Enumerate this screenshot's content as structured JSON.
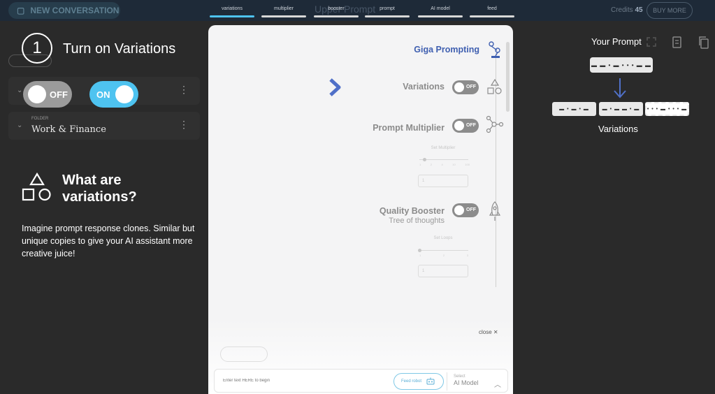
{
  "background": {
    "new_conversation": "NEW CONVERSATION",
    "app_title": "Upper Prompt",
    "credits_label": "Credits",
    "credits_value": "45",
    "buy_more": "BUY MORE",
    "folder_small": "FOLDER",
    "folder_name": "Work & Finance"
  },
  "tabs": [
    {
      "label": "variations",
      "active": true
    },
    {
      "label": "multiplier",
      "active": false
    },
    {
      "label": "booster",
      "active": false
    },
    {
      "label": "prompt",
      "active": false
    },
    {
      "label": "AI model",
      "active": false
    },
    {
      "label": "feed",
      "active": false
    }
  ],
  "tutorial": {
    "step_number": "1",
    "step_title": "Turn on Variations",
    "toggle_off_label": "OFF",
    "toggle_on_label": "ON",
    "what_title_line1": "What are",
    "what_title_line2": "variations?",
    "description": "Imagine prompt response clones. Similar but unique copies to give your AI assistant more creative juice!"
  },
  "modal": {
    "giga_prompting": "Giga Prompting",
    "variations_label": "Variations",
    "variations_toggle": "OFF",
    "multiplier_label": "Prompt Multiplier",
    "multiplier_toggle": "OFF",
    "set_multiplier": "Set Multiplier",
    "multiplier_ticks": [
      "1",
      "2",
      "4",
      "10",
      "100"
    ],
    "multiplier_value": "1",
    "booster_label": "Quality Booster",
    "booster_sublabel": "Tree of thoughts",
    "booster_toggle": "OFF",
    "set_loops": "Set Loops",
    "loops_ticks": [
      "1",
      "2",
      "3"
    ],
    "loops_value": "1",
    "close": "close ✕",
    "input_placeholder": "Enter text HERE to begin",
    "feed_robot": "Feed robot",
    "select_label": "Select",
    "ai_model": "AI Model"
  },
  "right_panel": {
    "your_prompt": "Your Prompt",
    "prompt_dots": "▬ ▬ • ▬ • • • ▬ ▬",
    "variation_dots": [
      "▬ • ▬ • ▬",
      "▬ • ▬ ▬ • ▬",
      "• • • ▬ • • • ▬"
    ],
    "variations_label": "Variations"
  },
  "colors": {
    "accent_blue": "#4ec3f0",
    "giga_blue": "#3f5fb0",
    "arrow_blue": "#5070c8",
    "background": "#2a2a2a"
  }
}
